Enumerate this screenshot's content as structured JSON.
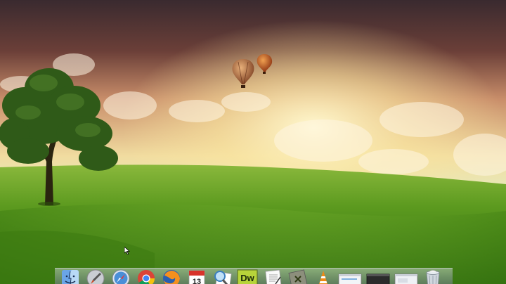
{
  "desktop": {
    "wallpaper": "green-hills-tree-balloons-wallpaper",
    "colors": {
      "sky_top": "#3d2b2e",
      "glow": "#fff3b0",
      "grass": "#5a9a1e"
    }
  },
  "dock": {
    "items": [
      {
        "name": "finder",
        "icon": "finder-icon"
      },
      {
        "name": "launchpad",
        "icon": "rocket-icon"
      },
      {
        "name": "safari",
        "icon": "compass-icon"
      },
      {
        "name": "chrome",
        "icon": "chrome-icon"
      },
      {
        "name": "firefox",
        "icon": "firefox-icon"
      },
      {
        "name": "calendar",
        "icon": "calendar-icon",
        "day": "13"
      },
      {
        "name": "preview",
        "icon": "preview-icon"
      },
      {
        "name": "dreamweaver",
        "icon": "dreamweaver-icon",
        "label": "Dw"
      },
      {
        "name": "textedit",
        "icon": "document-icon"
      },
      {
        "name": "script-editor",
        "icon": "script-icon"
      },
      {
        "name": "vlc",
        "icon": "traffic-cone-icon"
      },
      {
        "name": "window-1",
        "icon": "window-thumbnail-icon"
      },
      {
        "name": "window-2",
        "icon": "window-thumbnail-icon"
      },
      {
        "name": "window-3",
        "icon": "window-thumbnail-icon"
      },
      {
        "name": "trash",
        "icon": "trash-icon"
      }
    ]
  }
}
